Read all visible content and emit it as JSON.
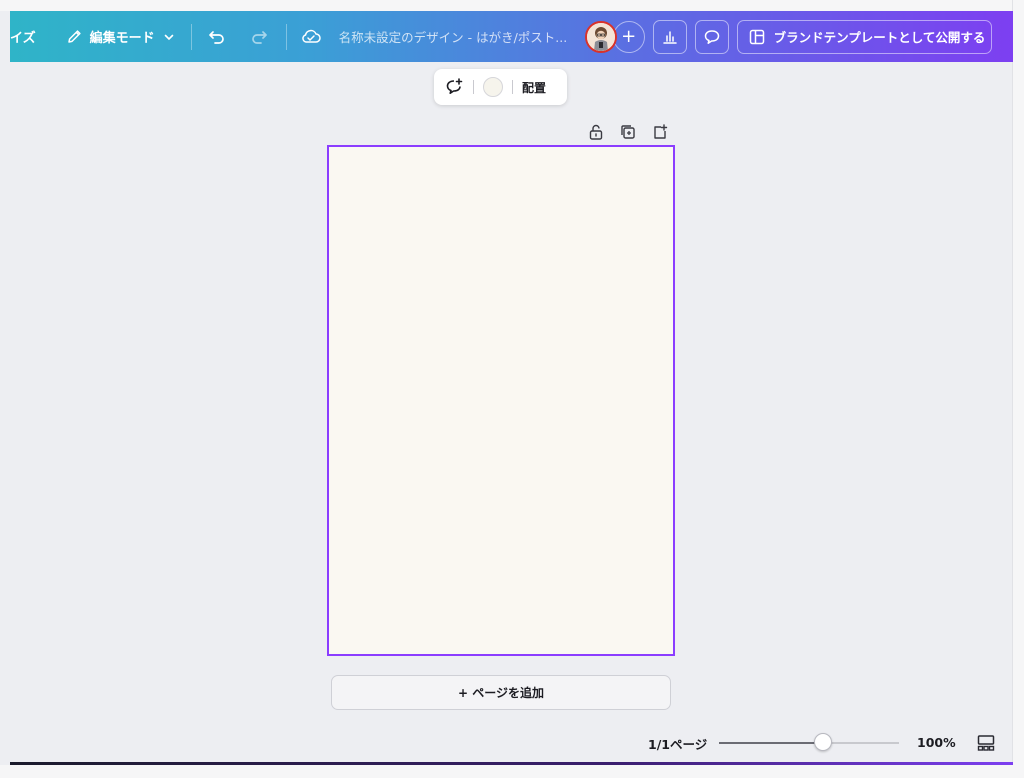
{
  "topbar": {
    "resize_label": "イズ",
    "edit_mode_label": "編集モード",
    "doc_title": "名称未設定のデザイン - はがき/ポスト...",
    "add_collaborator": "+",
    "publish_label": "ブランドテンプレートとして公開する"
  },
  "floating_toolbar": {
    "arrange_label": "配置",
    "swatch_color": "#f6f4ec"
  },
  "canvas": {
    "background": "#faf8f2",
    "selection_color": "#8b3dff"
  },
  "add_page_label": "+ ページを追加",
  "footer": {
    "page_indicator": "1/1ページ",
    "zoom_label": "100%",
    "zoom_level": 0.58
  }
}
